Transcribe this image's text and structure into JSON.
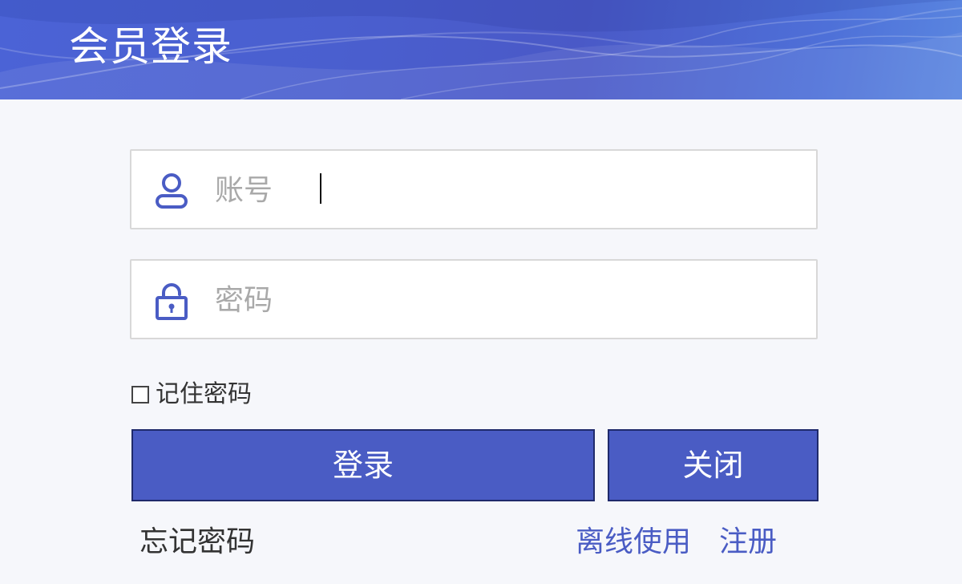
{
  "header": {
    "title": "会员登录"
  },
  "form": {
    "account": {
      "placeholder": "账号",
      "value": ""
    },
    "password": {
      "placeholder": "密码",
      "value": ""
    },
    "remember_label": "记住密码"
  },
  "buttons": {
    "login_label": "登录",
    "close_label": "关闭"
  },
  "links": {
    "forgot": "忘记密码",
    "offline": "离线使用",
    "register": "注册"
  },
  "icons": {
    "account": "user-icon",
    "password": "unlock-icon"
  },
  "colors": {
    "accent": "#4a5cc4",
    "header_gradient_start": "#4b63d6",
    "header_gradient_end": "#5a86e0",
    "background": "#f6f7fb",
    "placeholder_text": "#a9a9a9",
    "field_border": "#d8d8d8",
    "button_border": "#1f2a6b"
  }
}
